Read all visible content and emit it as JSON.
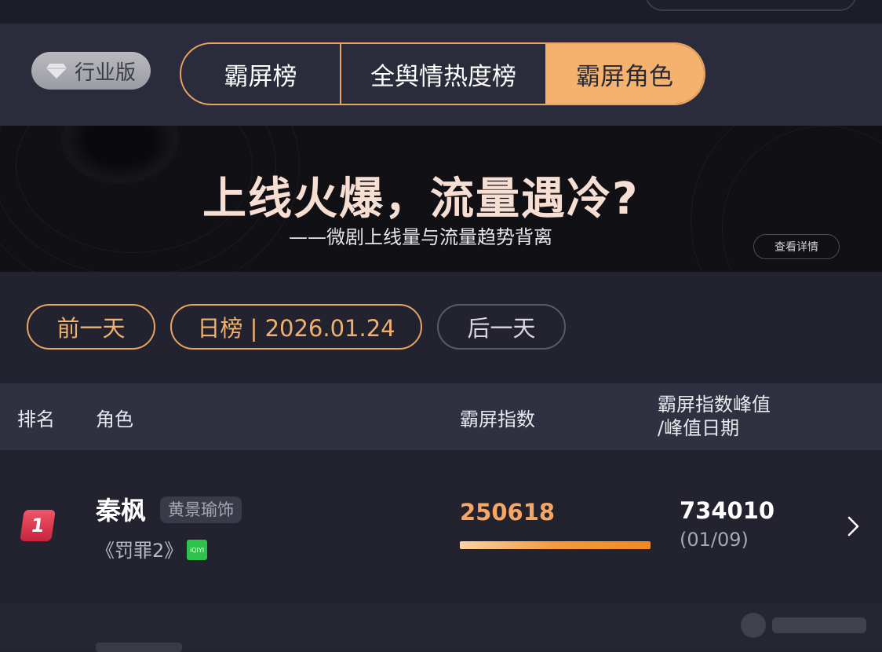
{
  "header": {
    "industry_label": "行业版",
    "tabs": [
      {
        "label": "霸屏榜",
        "active": false
      },
      {
        "label": "全舆情热度榜",
        "active": false
      },
      {
        "label": "霸屏角色",
        "active": true
      }
    ]
  },
  "banner": {
    "title": "上线火爆，流量遇冷?",
    "subtitle": "——微剧上线量与流量趋势背离",
    "details_label": "查看详情"
  },
  "date_nav": {
    "prev_label": "前一天",
    "current_label": "日榜 | 2026.01.24",
    "next_label": "后一天"
  },
  "table": {
    "columns": {
      "rank": "排名",
      "role": "角色",
      "index": "霸屏指数",
      "peak_line1": "霸屏指数峰值",
      "peak_line2": "/峰值日期"
    },
    "rows": [
      {
        "rank": "1",
        "character": "秦枫",
        "actor": "黄景瑜饰",
        "drama": "《罚罪2》",
        "platform": "iQIYI",
        "index": "250618",
        "index_bar_fraction": 0.34,
        "peak": "734010",
        "peak_date": "(01/09)"
      }
    ]
  },
  "colors": {
    "accent": "#f5b26e",
    "rank_badge": "#e0354d",
    "background": "#23232f",
    "platform": "#2fc24a"
  }
}
